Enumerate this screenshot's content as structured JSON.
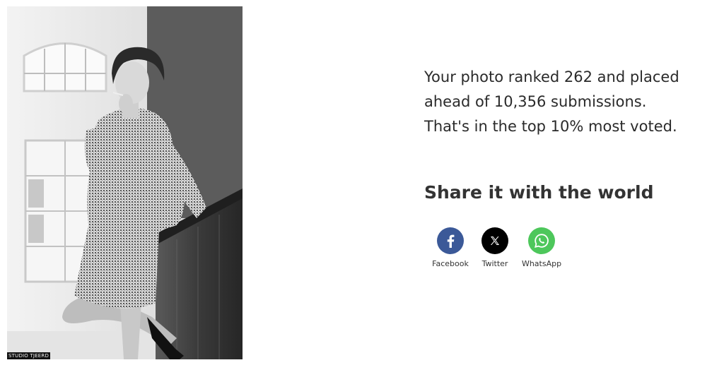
{
  "photo": {
    "watermark": "STUDIO TJEERD"
  },
  "result": {
    "line1": "Your photo ranked 262 and placed",
    "line2": "ahead of 10,356 submissions.",
    "line3": "That's in the top 10% most voted."
  },
  "share": {
    "heading": "Share it with the world",
    "buttons": [
      {
        "label": "Facebook",
        "icon": "facebook-icon",
        "color": "#3b5998"
      },
      {
        "label": "Twitter",
        "icon": "x-twitter-icon",
        "color": "#000000"
      },
      {
        "label": "WhatsApp",
        "icon": "whatsapp-icon",
        "color": "#4dc75b"
      }
    ]
  }
}
